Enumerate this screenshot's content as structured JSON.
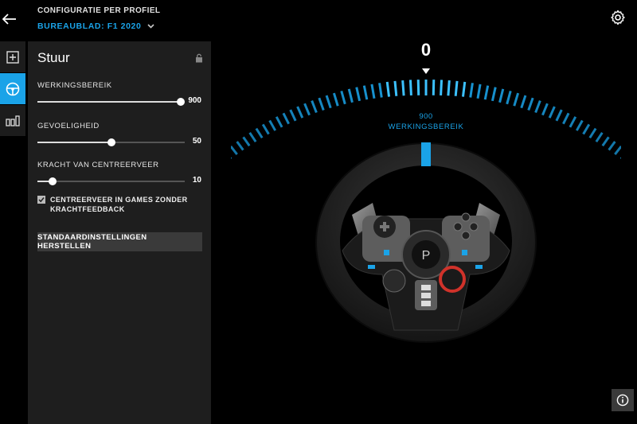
{
  "header": {
    "section_label": "CONFIGURATIE PER PROFIEL",
    "profile_selector": "BUREAUBLAD: F1 2020"
  },
  "panel": {
    "title": "Stuur",
    "settings": [
      {
        "label": "WERKINGSBEREIK",
        "value": "900",
        "fraction": 1.0
      },
      {
        "label": "GEVOELIGHEID",
        "value": "50",
        "fraction": 0.5
      },
      {
        "label": "KRACHT VAN CENTREERVEER",
        "value": "10",
        "fraction": 0.1
      }
    ],
    "checkbox_label": "CENTREERVEER IN GAMES ZONDER KRACHTFEEDBACK",
    "checkbox_checked": true,
    "reset_button": "STANDAARDINSTELLINGEN HERSTELLEN"
  },
  "display": {
    "angle": "0",
    "range_value": "900",
    "range_label": "WERKINGSBEREIK"
  },
  "colors": {
    "accent": "#1aa3e8",
    "panel_bg": "#1e1e1e"
  },
  "icons": {
    "back": "arrow-left-icon",
    "settings": "gear-icon",
    "rail": [
      "plus-square-icon",
      "steering-wheel-icon",
      "pedals-icon"
    ],
    "lock": "lock-icon",
    "info": "info-icon"
  }
}
